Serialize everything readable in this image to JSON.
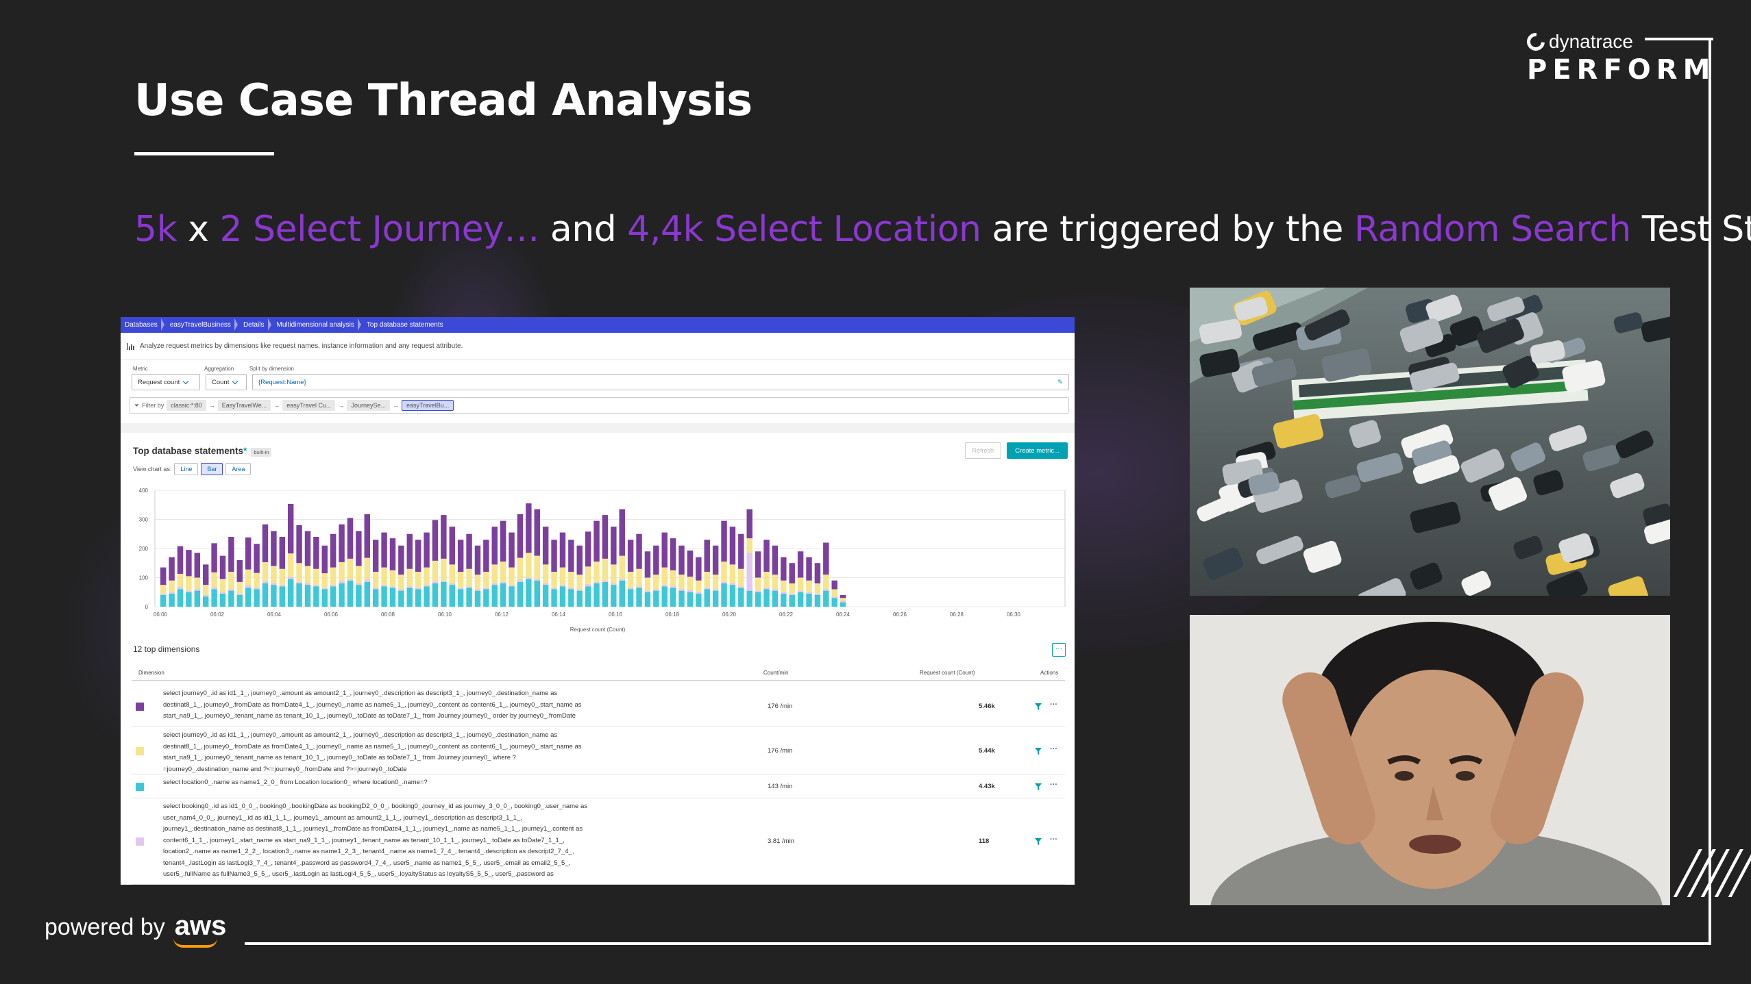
{
  "slide": {
    "title": "Use Case Thread Analysis",
    "subtitle_parts": [
      {
        "text": "5k",
        "highlight": true
      },
      {
        "text": " x ",
        "highlight": false
      },
      {
        "text": "2 Select Journey…",
        "highlight": true
      },
      {
        "text": " and ",
        "highlight": false
      },
      {
        "text": "4,4k Select Location",
        "highlight": true
      },
      {
        "text": " are triggered by the ",
        "highlight": false
      },
      {
        "text": "Random Search",
        "highlight": true
      },
      {
        "text": " Test Step",
        "highlight": false
      }
    ],
    "highlight_color": "#8a38cf"
  },
  "brand": {
    "company": "dynatrace",
    "event": "PERFORM"
  },
  "footer": {
    "powered_by": "powered by",
    "aws": "aws"
  },
  "screenshot": {
    "breadcrumbs": [
      "Databases",
      "easyTravelBusiness",
      "Details",
      "Multidimensional analysis",
      "Top database statements"
    ],
    "description": "Analyze request metrics by dimensions like request names, instance information and any request attribute.",
    "labels": {
      "metric": "Metric",
      "aggregation": "Aggregation",
      "split": "Split by dimension"
    },
    "metric_value": "Request count",
    "aggregation_value": "Count",
    "split_value": "{Request:Name}",
    "filter_label": "Filter by",
    "filter_chips": [
      "classic:*:80",
      "EasyTravelWe...",
      "easyTravel Cu...",
      "JourneySe...",
      "easyTravelBu..."
    ],
    "section_title": "Top database statements",
    "builtin_badge": "built-in",
    "refresh_label": "Refresh",
    "create_label": "Create metric...",
    "view_chart_as": "View chart as:",
    "view_options": [
      "Line",
      "Bar",
      "Area"
    ],
    "view_selected": "Bar",
    "top_dimensions": "12 top dimensions",
    "more_button": "···",
    "columns": {
      "dimension": "Dimension",
      "count_min": "Count/min",
      "request_count": "Request count (Count)",
      "actions": "Actions"
    },
    "rows": [
      {
        "color": "#7b3f9e",
        "sql": [
          "select journey0_.id as id1_1_, journey0_.amount as amount2_1_, journey0_.description as descript3_1_, journey0_.destination_name as",
          "destinat8_1_, journey0_.fromDate as fromDate4_1_, journey0_.name as name5_1_, journey0_.content as content6_1_, journey0_.start_name as",
          "start_na9_1_, journey0_.tenant_name as tenant_10_1_, journey0_.toDate as toDate7_1_ from Journey journey0_ order by journey0_.fromDate"
        ],
        "count_min": "176 /min",
        "count": "5.46k"
      },
      {
        "color": "#f6e58d",
        "sql": [
          "select journey0_.id as id1_1_, journey0_.amount as amount2_1_, journey0_.description as descript3_1_, journey0_.destination_name as",
          "destinat8_1_, journey0_.fromDate as fromDate4_1_, journey0_.name as name5_1_, journey0_.content as content6_1_, journey0_.start_name as",
          "start_na9_1_, journey0_.tenant_name as tenant_10_1_, journey0_.toDate as toDate7_1_ from Journey journey0_ where ?",
          "=journey0_.destination_name and ?<=journey0_.fromDate and ?>=journey0_.toDate"
        ],
        "count_min": "176 /min",
        "count": "5.44k"
      },
      {
        "color": "#3cc8d6",
        "sql": [
          "select location0_.name as name1_2_0_ from Location location0_ where location0_.name=?"
        ],
        "count_min": "143 /min",
        "count": "4.43k"
      },
      {
        "color": "#e3c6f0",
        "sql": [
          "select booking0_.id as id1_0_0_, booking0_.bookingDate as bookingD2_0_0_, booking0_.journey_id as journey_3_0_0_, booking0_.user_name as",
          "user_nam4_0_0_, journey1_.id as id1_1_1_, journey1_.amount as amount2_1_1_, journey1_.description as descript3_1_1_,",
          "journey1_.destination_name as destinat8_1_1_, journey1_.fromDate as fromDate4_1_1_, journey1_.name as name5_1_1_, journey1_.content as",
          "content6_1_1_, journey1_.start_name as start_na9_1_1_, journey1_.tenant_name as tenant_10_1_1_, journey1_.toDate as toDate7_1_1_,",
          "location2_.name as name1_2_2_, location3_.name as name1_2_3_, tenant4_.name as name1_7_4_, tenant4_.description as descript2_7_4_,",
          "tenant4_.lastLogin as lastLogi3_7_4_, tenant4_.password as password4_7_4_, user5_.name as name1_5_5_, user5_.email as email2_5_5_,",
          "user5_.fullName as fullName3_5_5_, user5_.lastLogin as lastLogi4_5_5_, user5_.loyaltyStatus as loyaltyS5_5_5_, user5_.password as"
        ],
        "count_min": "3.81 /min",
        "count": "118"
      }
    ]
  },
  "chart_data": {
    "type": "bar",
    "stacked": true,
    "title": "Top database statements",
    "ylim": [
      0,
      400
    ],
    "yticks": [
      "0",
      "100",
      "200",
      "300",
      "400"
    ],
    "xticks": [
      "06:00",
      "06:02",
      "06:04",
      "06:06",
      "06:08",
      "06:10",
      "06:12",
      "06:14",
      "06:16",
      "06:18",
      "06:20",
      "06:22",
      "06:24",
      "06:26",
      "06:28",
      "06:30"
    ],
    "legend": "Request count (Count)",
    "series_colors": [
      "#3cc8d6",
      "#e3c6f0",
      "#f6e58d",
      "#7b3f9e"
    ],
    "series": [
      {
        "values": [
          40,
          45,
          60,
          50,
          55,
          35,
          60,
          45,
          55,
          40,
          65,
          60,
          80,
          75,
          70,
          95,
          80,
          75,
          70,
          60,
          70,
          80,
          90,
          75,
          85,
          60,
          70,
          65,
          55,
          65,
          60,
          70,
          80,
          85,
          75,
          60,
          65,
          55,
          60,
          75,
          80,
          70,
          85,
          95,
          90,
          75,
          60,
          70,
          60,
          55,
          70,
          80,
          85,
          75,
          90,
          60,
          65,
          50,
          55,
          70,
          65,
          55,
          50,
          45,
          60,
          55,
          80,
          75,
          65,
          55,
          50,
          60,
          55,
          45,
          40,
          50,
          45,
          40,
          55,
          30,
          15
        ]
      },
      {
        "values": [
          5,
          5,
          8,
          5,
          5,
          5,
          8,
          5,
          5,
          5,
          8,
          6,
          8,
          5,
          5,
          8,
          5,
          5,
          5,
          5,
          5,
          8,
          5,
          5,
          8,
          5,
          5,
          5,
          5,
          5,
          5,
          5,
          8,
          5,
          5,
          5,
          5,
          5,
          5,
          5,
          5,
          5,
          8,
          5,
          5,
          5,
          5,
          5,
          5,
          5,
          8,
          5,
          5,
          5,
          5,
          5,
          5,
          5,
          5,
          5,
          5,
          5,
          8,
          5,
          5,
          5,
          5,
          5,
          5,
          130,
          5,
          5,
          5,
          5,
          5,
          5,
          5,
          5,
          5,
          5,
          5
        ]
      },
      {
        "values": [
          30,
          40,
          45,
          50,
          40,
          35,
          50,
          45,
          60,
          40,
          55,
          50,
          65,
          60,
          55,
          80,
          65,
          60,
          55,
          50,
          60,
          65,
          70,
          60,
          75,
          55,
          60,
          55,
          50,
          60,
          55,
          60,
          70,
          75,
          65,
          55,
          60,
          50,
          55,
          65,
          70,
          60,
          75,
          85,
          80,
          65,
          55,
          60,
          55,
          50,
          60,
          70,
          75,
          65,
          80,
          55,
          60,
          45,
          50,
          60,
          55,
          50,
          45,
          40,
          55,
          50,
          70,
          65,
          60,
          50,
          45,
          55,
          50,
          40,
          35,
          45,
          40,
          35,
          50,
          25,
          10
        ]
      },
      {
        "values": [
          60,
          80,
          95,
          90,
          85,
          70,
          100,
          80,
          120,
          75,
          110,
          100,
          130,
          120,
          110,
          170,
          130,
          120,
          110,
          95,
          115,
          130,
          140,
          120,
          150,
          110,
          120,
          110,
          100,
          120,
          110,
          120,
          140,
          150,
          130,
          110,
          120,
          100,
          110,
          130,
          140,
          120,
          150,
          170,
          160,
          130,
          110,
          120,
          110,
          100,
          120,
          140,
          150,
          130,
          160,
          110,
          120,
          90,
          100,
          120,
          110,
          100,
          90,
          80,
          110,
          100,
          140,
          130,
          120,
          100,
          90,
          110,
          100,
          80,
          70,
          90,
          80,
          70,
          110,
          30,
          10
        ]
      }
    ]
  }
}
